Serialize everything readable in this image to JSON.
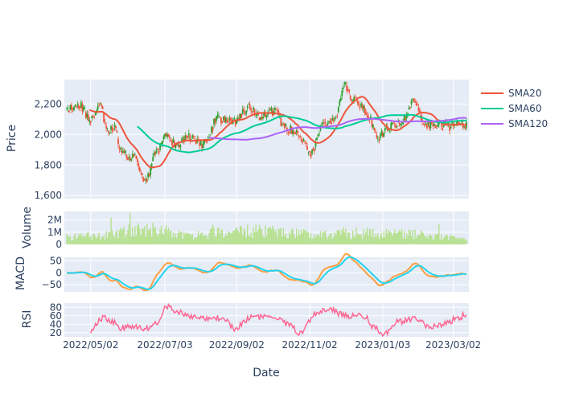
{
  "chart_data": {
    "type": "candlestick",
    "xlabel": "Date",
    "x_ticks": [
      "2022/05/02",
      "2022/07/03",
      "2022/09/02",
      "2022/11/02",
      "2023/01/03",
      "2023/03/02"
    ],
    "colors": {
      "increasing": "#2ca02c",
      "decreasing": "#ef553b",
      "sma20": "#ef553b",
      "sma60": "#00cc96",
      "sma120": "#ab63fa",
      "volume": "#b5e08c",
      "macd": "#ff9f43",
      "signal": "#22d3ee",
      "rsi": "#ff6692",
      "panel_bg": "#e5ecf6",
      "grid": "#ffffff"
    },
    "legend": {
      "placement": "right",
      "items": [
        {
          "name": "SMA20",
          "color": "#ef553b"
        },
        {
          "name": "SMA60",
          "color": "#00cc96"
        },
        {
          "name": "SMA120",
          "color": "#ab63fa"
        }
      ]
    },
    "panels": {
      "price": {
        "ylabel": "Price",
        "ylim": [
          1580,
          2360
        ],
        "ticks": [
          1600,
          1800,
          2000,
          2200
        ],
        "tick_labels": [
          "1,600",
          "1,800",
          "2,000",
          "2,200"
        ]
      },
      "volume": {
        "ylabel": "Volume",
        "ylim": [
          0,
          2700000
        ],
        "ticks": [
          0,
          1000000,
          2000000
        ],
        "tick_labels": [
          "0",
          "1M",
          "2M"
        ]
      },
      "macd": {
        "ylabel": "MACD",
        "ylim": [
          -80,
          65
        ],
        "ticks": [
          -50,
          0,
          50
        ],
        "tick_labels": [
          "−50",
          "0",
          "50"
        ]
      },
      "rsi": {
        "ylabel": "RSI",
        "ylim": [
          10,
          90
        ],
        "ticks": [
          20,
          40,
          60,
          80
        ],
        "tick_labels": [
          "20",
          "40",
          "60",
          "80"
        ]
      }
    },
    "price_waypoints": [
      [
        0,
        2160
      ],
      [
        10,
        2200
      ],
      [
        20,
        2100
      ],
      [
        28,
        2220
      ],
      [
        33,
        2030
      ],
      [
        40,
        2060
      ],
      [
        46,
        1870
      ],
      [
        56,
        1850
      ],
      [
        66,
        1690
      ],
      [
        74,
        1870
      ],
      [
        82,
        1980
      ],
      [
        92,
        1930
      ],
      [
        102,
        1980
      ],
      [
        114,
        1930
      ],
      [
        126,
        2100
      ],
      [
        140,
        2080
      ],
      [
        152,
        2180
      ],
      [
        162,
        2110
      ],
      [
        174,
        2150
      ],
      [
        182,
        2050
      ],
      [
        194,
        2000
      ],
      [
        204,
        1870
      ],
      [
        214,
        2050
      ],
      [
        224,
        2100
      ],
      [
        232,
        2320
      ],
      [
        240,
        2220
      ],
      [
        250,
        2150
      ],
      [
        260,
        1980
      ],
      [
        270,
        2050
      ],
      [
        282,
        2100
      ],
      [
        290,
        2220
      ],
      [
        300,
        2060
      ],
      [
        310,
        2060
      ],
      [
        320,
        2050
      ],
      [
        328,
        2080
      ],
      [
        334,
        2060
      ]
    ],
    "volume_waypoints": [
      [
        0,
        700000
      ],
      [
        30,
        900000
      ],
      [
        64,
        1400000
      ],
      [
        110,
        1000000
      ],
      [
        150,
        1300000
      ],
      [
        200,
        1000000
      ],
      [
        240,
        1100000
      ],
      [
        290,
        1000000
      ],
      [
        334,
        500000
      ]
    ],
    "rsi_waypoints": [
      [
        20,
        25
      ],
      [
        30,
        55
      ],
      [
        40,
        45
      ],
      [
        46,
        30
      ],
      [
        56,
        35
      ],
      [
        68,
        30
      ],
      [
        74,
        40
      ],
      [
        84,
        82
      ],
      [
        92,
        70
      ],
      [
        110,
        55
      ],
      [
        130,
        55
      ],
      [
        140,
        30
      ],
      [
        154,
        55
      ],
      [
        170,
        60
      ],
      [
        186,
        40
      ],
      [
        194,
        20
      ],
      [
        210,
        70
      ],
      [
        222,
        72
      ],
      [
        232,
        60
      ],
      [
        248,
        60
      ],
      [
        258,
        30
      ],
      [
        264,
        15
      ],
      [
        276,
        45
      ],
      [
        292,
        55
      ],
      [
        302,
        35
      ],
      [
        314,
        40
      ],
      [
        328,
        55
      ],
      [
        334,
        65
      ]
    ]
  }
}
